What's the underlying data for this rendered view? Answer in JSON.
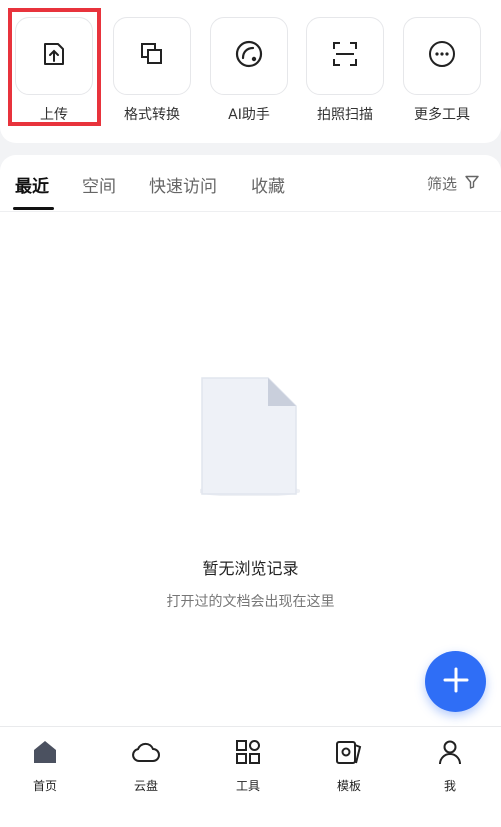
{
  "tools": [
    {
      "label": "上传",
      "icon": "upload-icon"
    },
    {
      "label": "格式转换",
      "icon": "format-convert-icon"
    },
    {
      "label": "AI助手",
      "icon": "ai-assistant-icon"
    },
    {
      "label": "拍照扫描",
      "icon": "scan-icon"
    },
    {
      "label": "更多工具",
      "icon": "more-icon"
    }
  ],
  "tabs": [
    "最近",
    "空间",
    "快速访问",
    "收藏"
  ],
  "filter": {
    "label": "筛选",
    "icon": "filter-icon"
  },
  "empty": {
    "title": "暂无浏览记录",
    "subtitle": "打开过的文档会出现在这里",
    "icon": "blank-document-icon"
  },
  "fab": {
    "icon": "plus-icon"
  },
  "bottom_nav": [
    {
      "label": "首页",
      "icon": "home-icon"
    },
    {
      "label": "云盘",
      "icon": "cloud-icon"
    },
    {
      "label": "工具",
      "icon": "grid-icon"
    },
    {
      "label": "模板",
      "icon": "template-icon"
    },
    {
      "label": "我",
      "icon": "user-icon"
    }
  ],
  "colors": {
    "accent": "#2f6ef6",
    "highlight": "#e8333c"
  }
}
